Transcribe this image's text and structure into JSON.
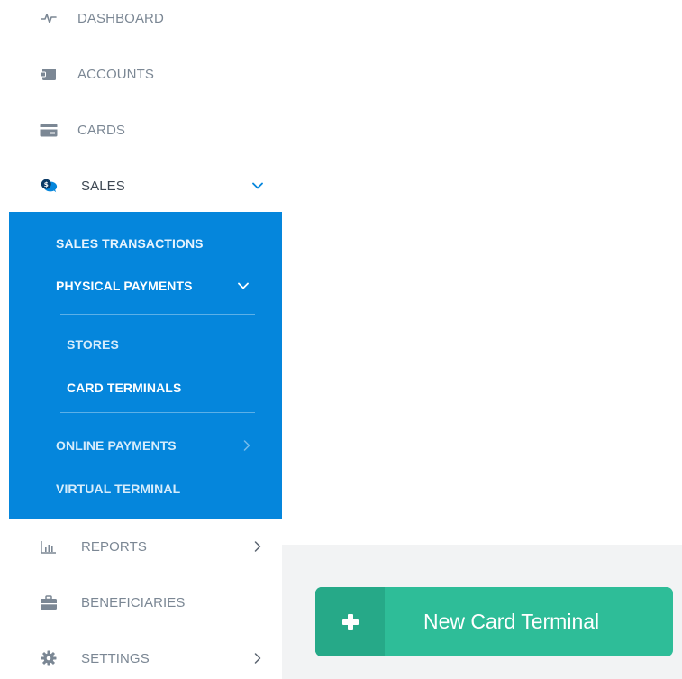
{
  "sidebar": {
    "items": [
      {
        "label": "DASHBOARD",
        "icon": "activity-icon"
      },
      {
        "label": "ACCOUNTS",
        "icon": "wallet-icon"
      },
      {
        "label": "CARDS",
        "icon": "card-icon"
      },
      {
        "label": "SALES",
        "icon": "sales-chat-icon"
      },
      {
        "label": "REPORTS",
        "icon": "bar-chart-icon"
      },
      {
        "label": "BENEFICIARIES",
        "icon": "briefcase-icon"
      },
      {
        "label": "SETTINGS",
        "icon": "gear-icon"
      }
    ],
    "sales_submenu": {
      "sales_transactions": "SALES TRANSACTIONS",
      "physical_payments": "PHYSICAL PAYMENTS",
      "stores": "STORES",
      "card_terminals": "CARD TERMINALS",
      "online_payments": "ONLINE PAYMENTS",
      "virtual_terminal": "VIRTUAL TERMINAL"
    }
  },
  "main": {
    "new_button_label": "New Card Terminal",
    "new_button_icon": "plus-icon"
  },
  "colors": {
    "submenu_bg": "#0586dc",
    "accent_blue": "#0586dc",
    "button_green": "#2ebd98",
    "button_green_dark": "#26a988",
    "content_bg": "#f2f3f4"
  }
}
